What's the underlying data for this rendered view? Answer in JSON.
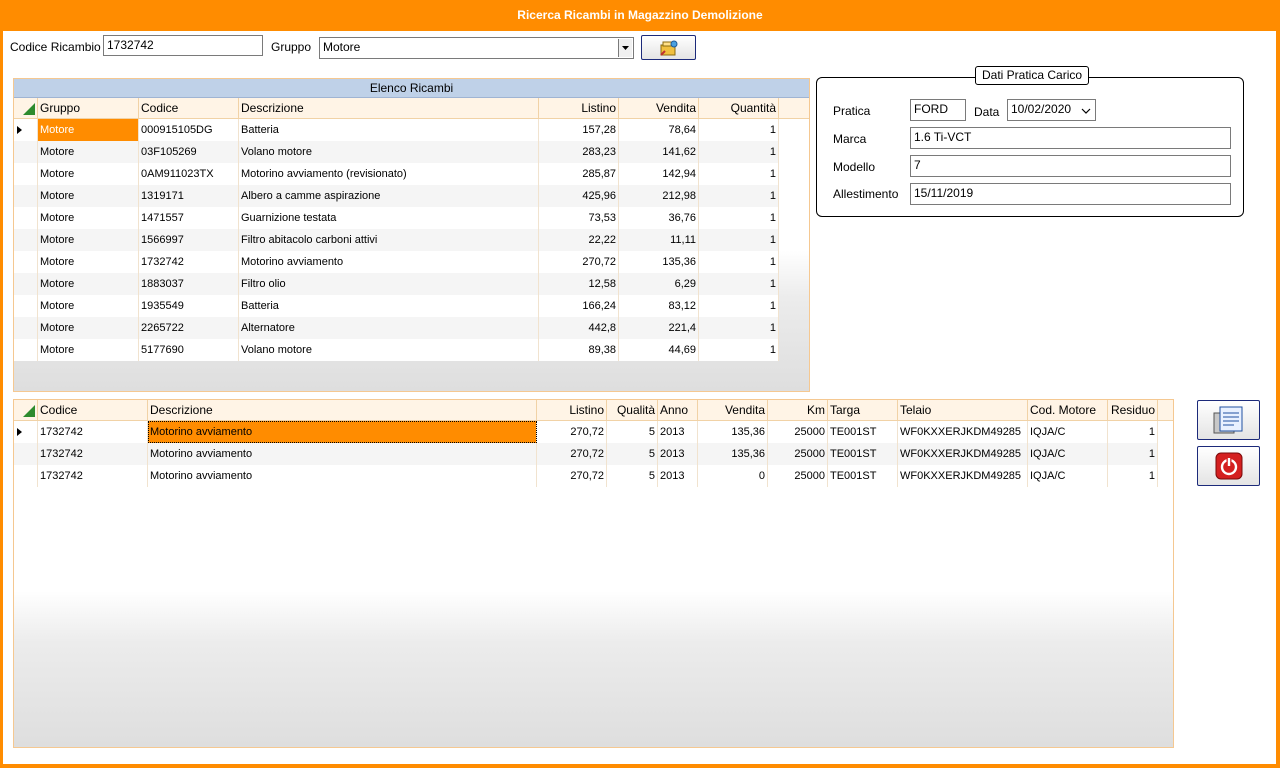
{
  "window": {
    "title": "Ricerca Ricambi in Magazzino Demolizione"
  },
  "search": {
    "codice_label": "Codice Ricambio",
    "codice_value": "1732742",
    "gruppo_label": "Gruppo",
    "gruppo_value": "Motore"
  },
  "elenco": {
    "caption": "Elenco Ricambi",
    "columns": [
      "Gruppo",
      "Codice",
      "Descrizione",
      "Listino",
      "Vendita",
      "Quantità"
    ],
    "rows": [
      [
        "Motore",
        "000915105DG",
        "Batteria",
        "157,28",
        "78,64",
        "1"
      ],
      [
        "Motore",
        "03F105269",
        "Volano motore",
        "283,23",
        "141,62",
        "1"
      ],
      [
        "Motore",
        "0AM911023TX",
        "Motorino avviamento (revisionato)",
        "285,87",
        "142,94",
        "1"
      ],
      [
        "Motore",
        "1319171",
        "Albero a camme aspirazione",
        "425,96",
        "212,98",
        "1"
      ],
      [
        "Motore",
        "1471557",
        "Guarnizione testata",
        "73,53",
        "36,76",
        "1"
      ],
      [
        "Motore",
        "1566997",
        "Filtro abitacolo carboni attivi",
        "22,22",
        "11,11",
        "1"
      ],
      [
        "Motore",
        "1732742",
        "Motorino avviamento",
        "270,72",
        "135,36",
        "1"
      ],
      [
        "Motore",
        "1883037",
        "Filtro olio",
        "12,58",
        "6,29",
        "1"
      ],
      [
        "Motore",
        "1935549",
        "Batteria",
        "166,24",
        "83,12",
        "1"
      ],
      [
        "Motore",
        "2265722",
        "Alternatore",
        "442,8",
        "221,4",
        "1"
      ],
      [
        "Motore",
        "5177690",
        "Volano motore",
        "89,38",
        "44,69",
        "1"
      ]
    ]
  },
  "dettaglio": {
    "columns": [
      "Codice",
      "Descrizione",
      "Listino",
      "Qualità",
      "Anno",
      "Vendita",
      "Km",
      "Targa",
      "Telaio",
      "Cod. Motore",
      "Residuo"
    ],
    "rows": [
      [
        "1732742",
        "Motorino avviamento",
        "270,72",
        "5",
        "2013",
        "135,36",
        "25000",
        "TE001ST",
        "WF0KXXERJKDM49285",
        "IQJA/C",
        "1"
      ],
      [
        "1732742",
        "Motorino avviamento",
        "270,72",
        "5",
        "2013",
        "135,36",
        "25000",
        "TE001ST",
        "WF0KXXERJKDM49285",
        "IQJA/C",
        "1"
      ],
      [
        "1732742",
        "Motorino avviamento",
        "270,72",
        "5",
        "2013",
        "0",
        "25000",
        "TE001ST",
        "WF0KXXERJKDM49285",
        "IQJA/C",
        "1"
      ]
    ]
  },
  "pratica": {
    "title": "Dati Pratica Carico",
    "pratica_label": "Pratica",
    "pratica_value": "FORD",
    "data_label": "Data",
    "data_value": "10/02/2020",
    "marca_label": "Marca",
    "marca_value": "1.6 Ti-VCT",
    "modello_label": "Modello",
    "modello_value": "7",
    "allestimento_label": "Allestimento",
    "allestimento_value": "15/11/2019"
  },
  "colors": {
    "accent": "#ff8c00",
    "caption": "#bfd1e8",
    "header": "#fff4e6"
  }
}
